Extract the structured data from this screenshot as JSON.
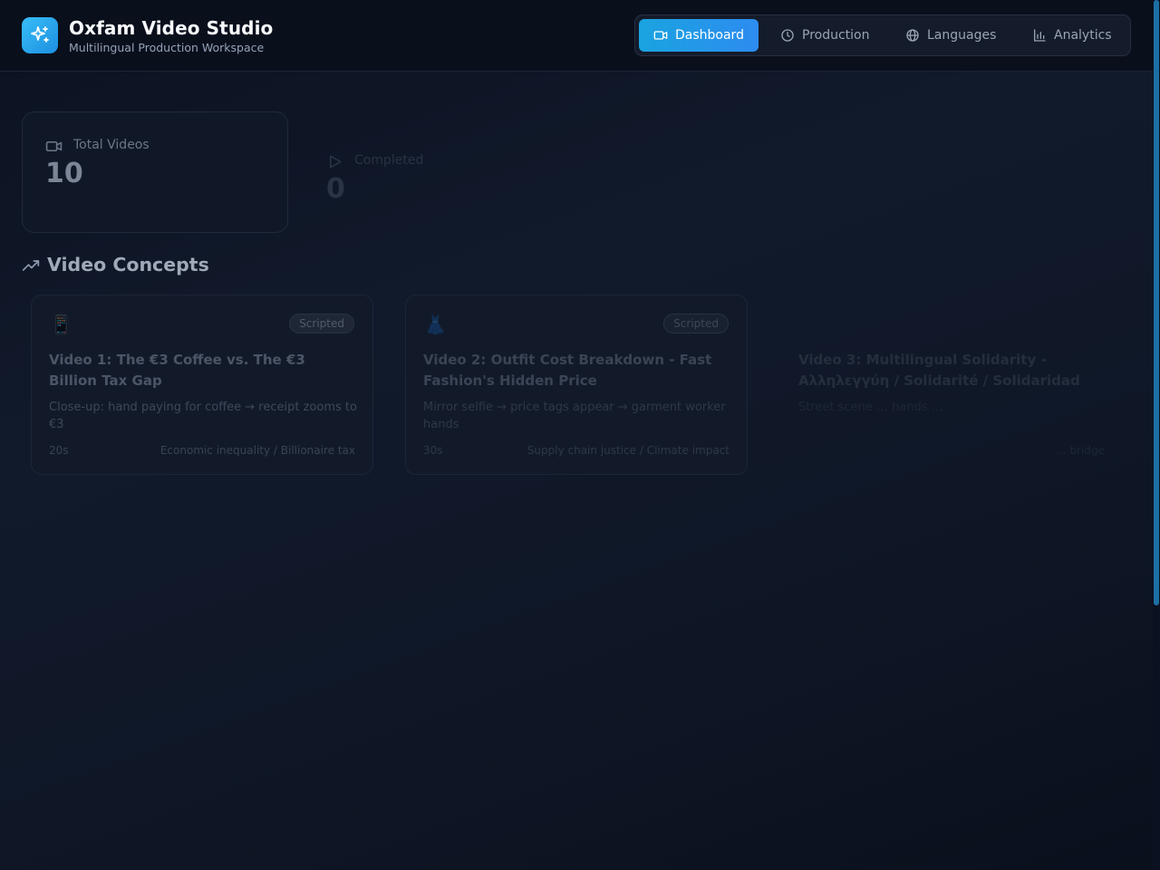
{
  "app": {
    "title": "Oxfam Video Studio",
    "subtitle": "Multilingual Production Workspace",
    "logo_icon": "sparkles-icon"
  },
  "nav": {
    "items": [
      {
        "label": "Dashboard",
        "icon": "video-camera-icon",
        "active": true
      },
      {
        "label": "Production",
        "icon": "clock-icon",
        "active": false
      },
      {
        "label": "Languages",
        "icon": "globe-icon",
        "active": false
      },
      {
        "label": "Analytics",
        "icon": "bar-chart-icon",
        "active": false
      }
    ]
  },
  "stats": [
    {
      "label": "Total Videos",
      "value": "10",
      "icon": "video-camera-icon"
    },
    {
      "label": "Completed",
      "value": "0",
      "icon": "play-icon"
    }
  ],
  "concepts_section": {
    "title": "Video Concepts",
    "icon": "trending-up-icon"
  },
  "concepts": [
    {
      "emoji": "📱",
      "status": "Scripted",
      "title": "Video 1: The €3 Coffee vs. The €3 Billion Tax Gap",
      "description": "Close-up: hand paying for coffee → receipt zooms to €3",
      "duration": "20s",
      "theme": "Economic inequality / Billionaire tax"
    },
    {
      "emoji": "👗",
      "status": "Scripted",
      "title": "Video 2: Outfit Cost Breakdown - Fast Fashion's Hidden Price",
      "description": "Mirror selfie → price tags appear → garment worker hands",
      "duration": "30s",
      "theme": "Supply chain justice / Climate impact"
    },
    {
      "emoji": "",
      "status": "",
      "title": "Video 3: Multilingual Solidarity - Αλληλεγγύη / Solidarité / Solidaridad",
      "description": "Street scene … hands …",
      "duration": "",
      "theme": "… bridge"
    }
  ],
  "colors": {
    "accent": "#1aa3e0",
    "background": "#0b1120",
    "topbar": "#0a0f1c"
  }
}
